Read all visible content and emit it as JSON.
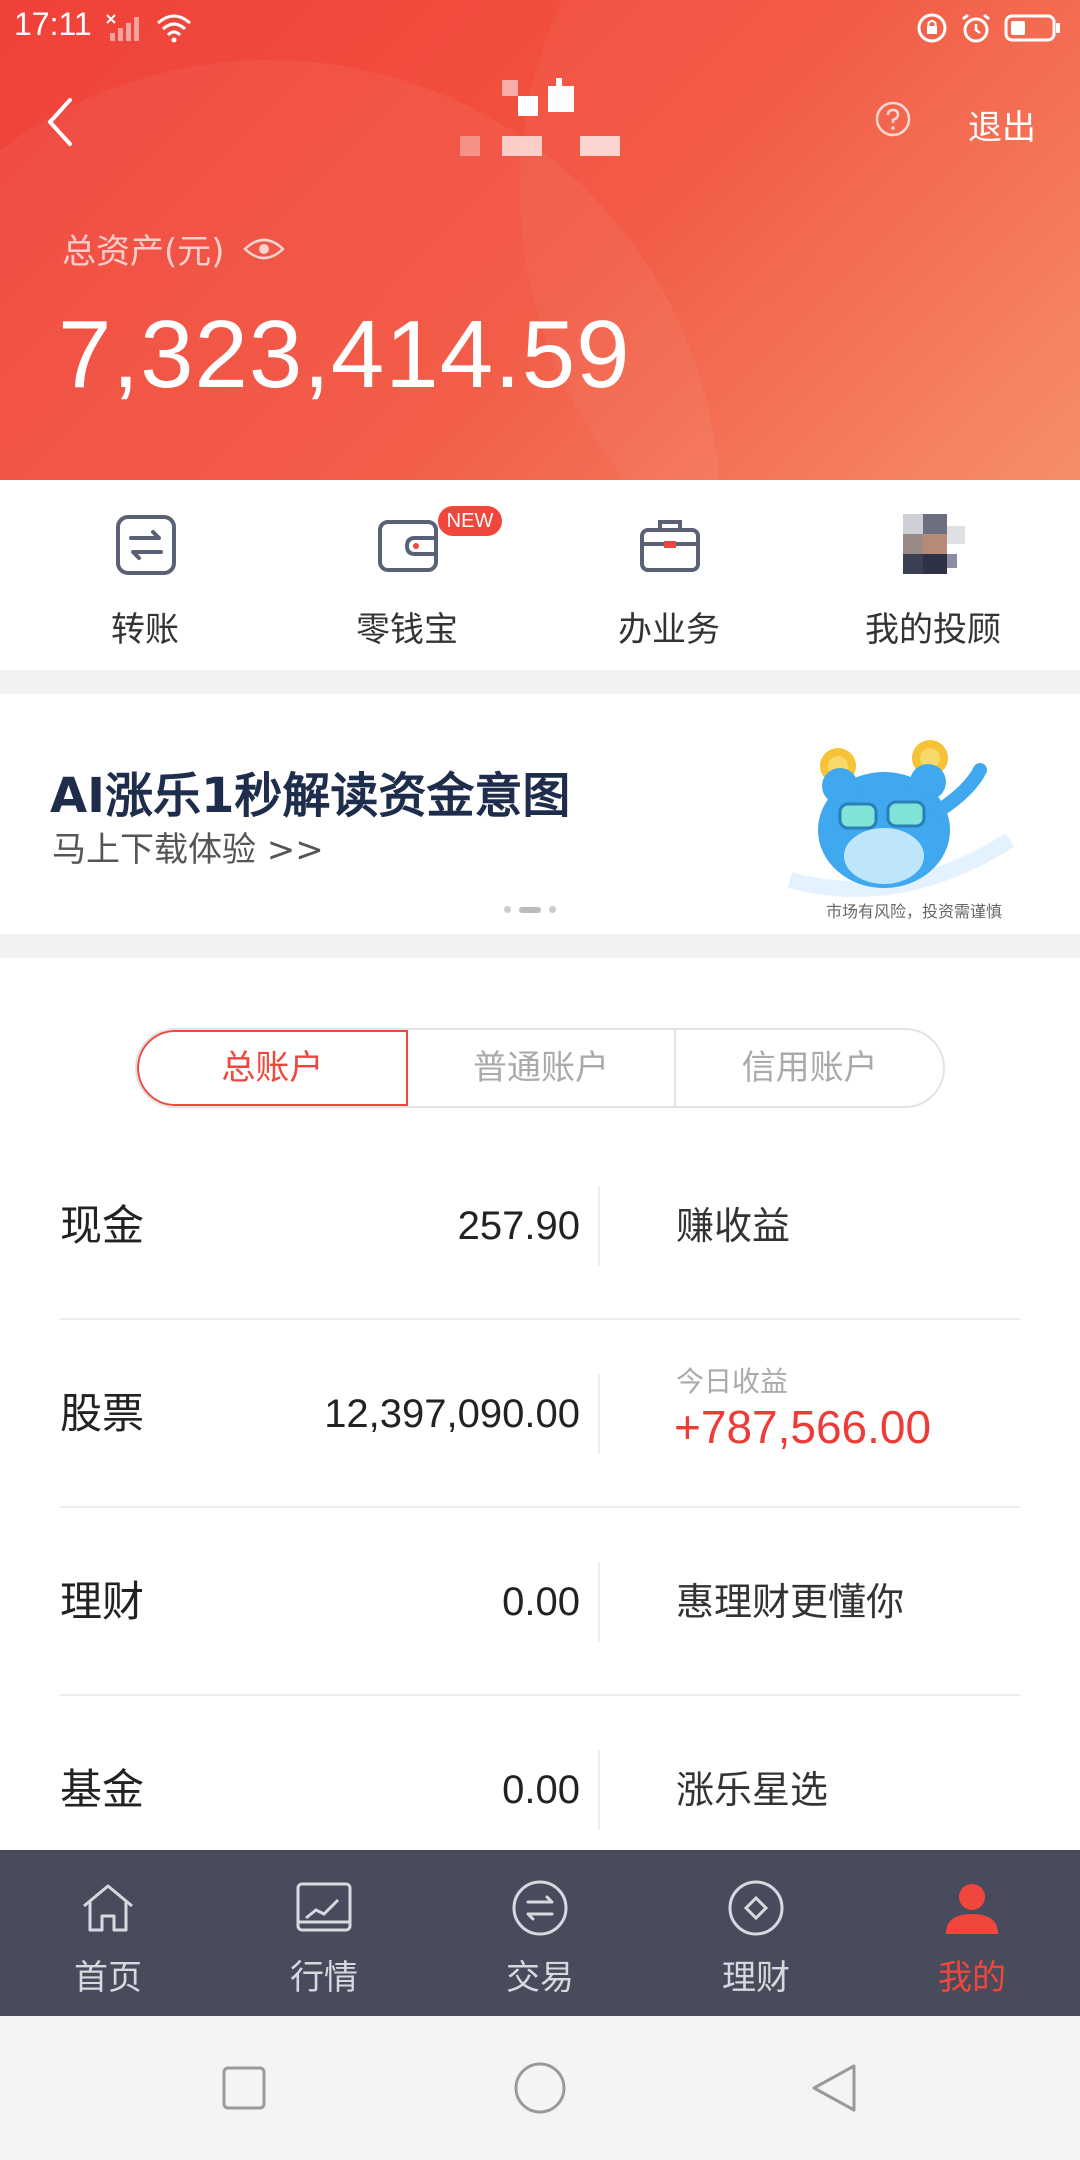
{
  "status_bar": {
    "time": "17:11"
  },
  "header": {
    "logout_label": "退出",
    "total_assets_label": "总资产(元)",
    "total_assets_value": "7,323,414.59"
  },
  "quick_actions": [
    {
      "label": "转账",
      "icon": "transfer-icon"
    },
    {
      "label": "零钱宝",
      "icon": "wallet-icon",
      "badge": "NEW"
    },
    {
      "label": "办业务",
      "icon": "briefcase-icon"
    },
    {
      "label": "我的投顾",
      "icon": "advisor-avatar"
    }
  ],
  "banner": {
    "title": "AI涨乐1秒解读资金意图",
    "subtitle": "马上下载体验 >>",
    "risk_note": "市场有风险，投资需谨慎"
  },
  "account_tabs": [
    "总账户",
    "普通账户",
    "信用账户"
  ],
  "asset_rows": [
    {
      "label": "现金",
      "value": "257.90",
      "promo": "赚收益"
    },
    {
      "label": "股票",
      "value": "12,397,090.00",
      "promo_small": "今日收益",
      "promo_big": "+787,566.00"
    },
    {
      "label": "理财",
      "value": "0.00",
      "promo": "惠理财更懂你"
    },
    {
      "label": "基金",
      "value": "0.00",
      "promo": "涨乐星选"
    }
  ],
  "bottom_nav": [
    {
      "label": "首页",
      "icon": "home-icon"
    },
    {
      "label": "行情",
      "icon": "market-chart-icon"
    },
    {
      "label": "交易",
      "icon": "trade-icon"
    },
    {
      "label": "理财",
      "icon": "finance-icon"
    },
    {
      "label": "我的",
      "icon": "profile-icon",
      "active": true
    }
  ],
  "colors": {
    "brand_red": "#f1463c",
    "nav_bg": "#474b5c",
    "profit_red": "#ee3b37"
  }
}
